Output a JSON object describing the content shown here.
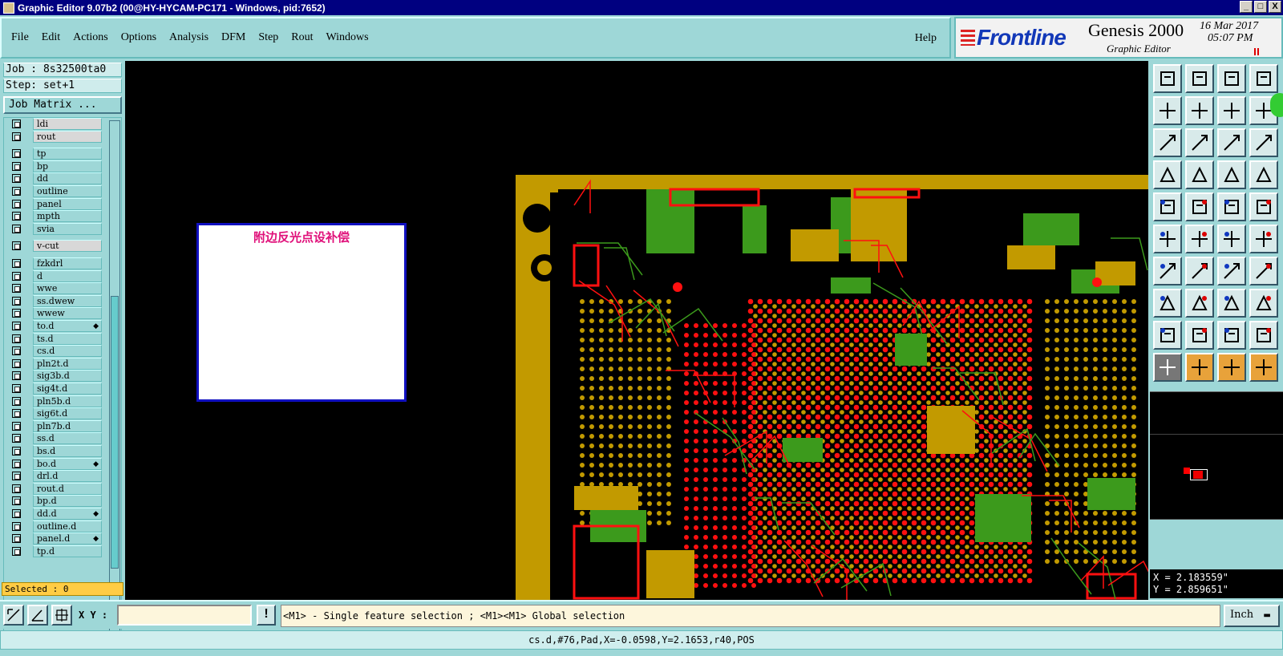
{
  "window": {
    "title": "Graphic Editor 9.07b2 (00@HY-HYCAM-PC171 - Windows, pid:7652)",
    "buttons": [
      "_",
      "□",
      "X"
    ]
  },
  "menu": [
    "File",
    "Edit",
    "Actions",
    "Options",
    "Analysis",
    "DFM",
    "Step",
    "Rout",
    "Windows"
  ],
  "help": "Help",
  "brand": {
    "logo": "Frontline",
    "product": "Genesis 2000",
    "subtitle": "Graphic Editor",
    "date": "16 Mar 2017",
    "time": "05:07 PM"
  },
  "job": {
    "job_line": "Job : 8s32500ta0",
    "step_line": "Step: set+1",
    "matrix_button": "Job Matrix ..."
  },
  "layers": [
    {
      "name": "ldi",
      "hi": true
    },
    {
      "name": "rout",
      "hi": true
    },
    {
      "name": "tp"
    },
    {
      "name": "bp"
    },
    {
      "name": "dd"
    },
    {
      "name": "outline"
    },
    {
      "name": "panel"
    },
    {
      "name": "mpth"
    },
    {
      "name": "svia"
    },
    {
      "name": "v-cut",
      "hi": true
    },
    {
      "name": "fzkdrl"
    },
    {
      "name": "d"
    },
    {
      "name": "wwe"
    },
    {
      "name": "ss.dwew"
    },
    {
      "name": "wwew"
    },
    {
      "name": "to.d",
      "mark": true
    },
    {
      "name": "ts.d"
    },
    {
      "name": "cs.d"
    },
    {
      "name": "pln2t.d"
    },
    {
      "name": "sig3b.d"
    },
    {
      "name": "sig4t.d"
    },
    {
      "name": "pln5b.d"
    },
    {
      "name": "sig6t.d"
    },
    {
      "name": "pln7b.d"
    },
    {
      "name": "ss.d"
    },
    {
      "name": "bs.d"
    },
    {
      "name": "bo.d",
      "mark": true
    },
    {
      "name": "drl.d"
    },
    {
      "name": "rout.d"
    },
    {
      "name": "bp.d"
    },
    {
      "name": "dd.d",
      "mark": true
    },
    {
      "name": "outline.d"
    },
    {
      "name": "panel.d",
      "mark": true
    },
    {
      "name": "tp.d"
    }
  ],
  "selected": "Selected : 0",
  "canvas": {
    "popup_title": "附边反光点设补偿",
    "colors": {
      "gold": "#c29a00",
      "green": "#3c9a1c",
      "red": "#ff1010"
    }
  },
  "coords": {
    "x": "X = 2.183559\"",
    "y": "Y = 2.859651\""
  },
  "bottom": {
    "xy_label": "X Y :",
    "xy_value": "",
    "prompt": "<M1> - Single feature selection ; <M1><M1> Global selection",
    "unit": "Inch"
  },
  "status": "cs.d,#76,Pad,X=-0.0598,Y=2.1653,r40,POS"
}
